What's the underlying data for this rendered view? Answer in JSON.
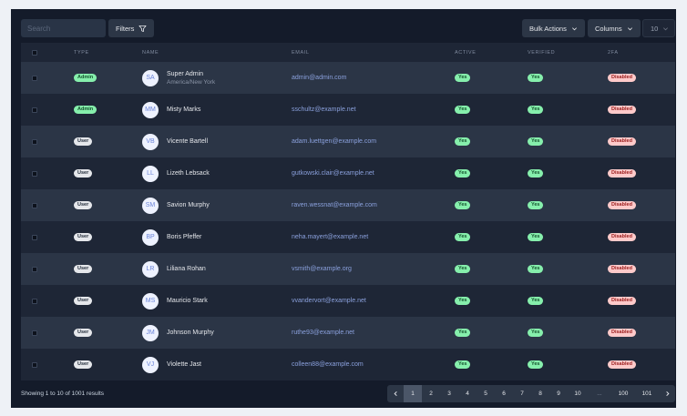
{
  "toolbar": {
    "search_placeholder": "Search",
    "filters_label": "Filters",
    "bulk_actions_label": "Bulk Actions",
    "columns_label": "Columns",
    "per_page": "10"
  },
  "table": {
    "headers": [
      "TYPE",
      "NAME",
      "EMAIL",
      "ACTIVE",
      "VERIFIED",
      "2FA"
    ],
    "rows": [
      {
        "type": "Admin",
        "initials": "SA",
        "name": "Super Admin",
        "subtitle": "America/New York",
        "email": "admin@admin.com",
        "active": "Yes",
        "verified": "Yes",
        "twofa": "Disabled"
      },
      {
        "type": "Admin",
        "initials": "MM",
        "name": "Misty Marks",
        "subtitle": "",
        "email": "sschultz@example.net",
        "active": "Yes",
        "verified": "Yes",
        "twofa": "Disabled"
      },
      {
        "type": "User",
        "initials": "VB",
        "name": "Vicente Bartell",
        "subtitle": "",
        "email": "adam.luettgen@example.com",
        "active": "Yes",
        "verified": "Yes",
        "twofa": "Disabled"
      },
      {
        "type": "User",
        "initials": "LL",
        "name": "Lizeth Lebsack",
        "subtitle": "",
        "email": "gutkowski.clair@example.net",
        "active": "Yes",
        "verified": "Yes",
        "twofa": "Disabled"
      },
      {
        "type": "User",
        "initials": "SM",
        "name": "Savion Murphy",
        "subtitle": "",
        "email": "raven.wessnat@example.com",
        "active": "Yes",
        "verified": "Yes",
        "twofa": "Disabled"
      },
      {
        "type": "User",
        "initials": "BP",
        "name": "Boris Pfeffer",
        "subtitle": "",
        "email": "neha.mayert@example.net",
        "active": "Yes",
        "verified": "Yes",
        "twofa": "Disabled"
      },
      {
        "type": "User",
        "initials": "LR",
        "name": "Liliana Rohan",
        "subtitle": "",
        "email": "vsmith@example.org",
        "active": "Yes",
        "verified": "Yes",
        "twofa": "Disabled"
      },
      {
        "type": "User",
        "initials": "MS",
        "name": "Mauricio Stark",
        "subtitle": "",
        "email": "vvandervort@example.net",
        "active": "Yes",
        "verified": "Yes",
        "twofa": "Disabled"
      },
      {
        "type": "User",
        "initials": "JM",
        "name": "Johnson Murphy",
        "subtitle": "",
        "email": "ruthe93@example.net",
        "active": "Yes",
        "verified": "Yes",
        "twofa": "Disabled"
      },
      {
        "type": "User",
        "initials": "VJ",
        "name": "Violette Jast",
        "subtitle": "",
        "email": "colleen88@example.com",
        "active": "Yes",
        "verified": "Yes",
        "twofa": "Disabled"
      }
    ]
  },
  "footer": {
    "summary": "Showing 1 to 10 of 1001 results",
    "pages": [
      "1",
      "2",
      "3",
      "4",
      "5",
      "6",
      "7",
      "8",
      "9",
      "10",
      "...",
      "100",
      "101"
    ],
    "current_page": "1"
  },
  "colors": {
    "background": "#141b2a",
    "row_alt": "#2b3546",
    "success": "#86efac",
    "danger": "#fecaca",
    "link": "#8aa0dc"
  }
}
